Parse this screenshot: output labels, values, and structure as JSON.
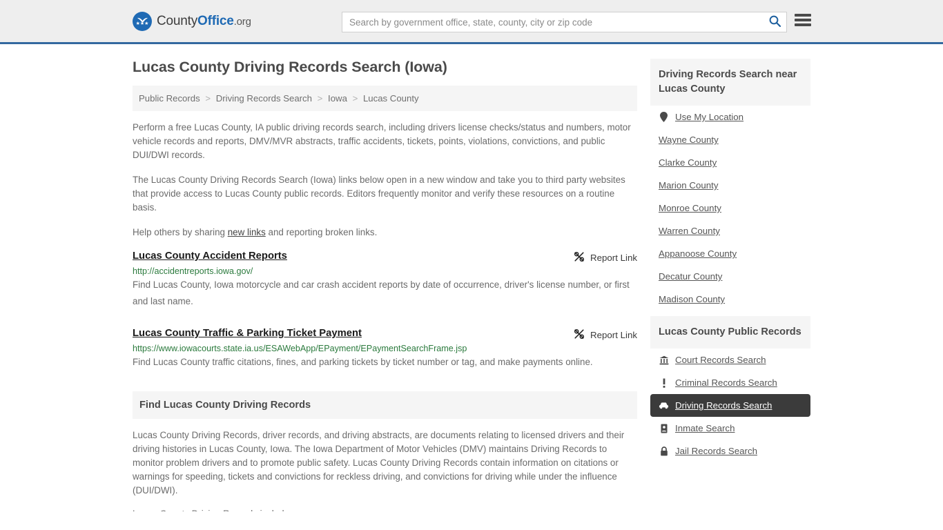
{
  "header": {
    "logo": {
      "part1": "County",
      "part2": "Office",
      "part3": ".org",
      "icon": "eagle-seal-icon",
      "stars": "★★★"
    },
    "search": {
      "placeholder": "Search by government office, state, county, city or zip code",
      "value": "",
      "icon": "search-icon"
    },
    "menu_icon": "hamburger-menu-icon",
    "accent_color": "#33689f"
  },
  "main": {
    "title": "Lucas County Driving Records Search (Iowa)",
    "breadcrumb": [
      {
        "label": "Public Records"
      },
      {
        "label": "Driving Records Search"
      },
      {
        "label": "Iowa"
      },
      {
        "label": "Lucas County"
      }
    ],
    "breadcrumb_separator": ">",
    "paragraphs": [
      "Perform a free Lucas County, IA public driving records search, including drivers license checks/status and numbers, motor vehicle records and reports, DMV/MVR abstracts, traffic accidents, tickets, points, violations, convictions, and public DUI/DWI records.",
      "The Lucas County Driving Records Search (Iowa) links below open in a new window and take you to third party websites that provide access to Lucas County public records. Editors frequently monitor and verify these resources on a routine basis."
    ],
    "help_text_before": "Help others by sharing ",
    "help_link": "new links",
    "help_text_after": " and reporting broken links.",
    "report_link_label": "Report Link",
    "report_link_icon": "broken-link-icon",
    "results": [
      {
        "title": "Lucas County Accident Reports",
        "url": "http://accidentreports.iowa.gov/",
        "description": "Find Lucas County, Iowa motorcycle and car crash accident reports by date of occurrence, driver's license number, or first and last name."
      },
      {
        "title": "Lucas County Traffic & Parking Ticket Payment",
        "url": "https://www.iowacourts.state.ia.us/ESAWebApp/EPayment/EPaymentSearchFrame.jsp",
        "description": "Find Lucas County traffic citations, fines, and parking tickets by ticket number or tag, and make payments online."
      }
    ],
    "section": {
      "heading": "Find Lucas County Driving Records",
      "body": "Lucas County Driving Records, driver records, and driving abstracts, are documents relating to licensed drivers and their driving histories in Lucas County, Iowa. The Iowa Department of Motor Vehicles (DMV) maintains Driving Records to monitor problem drivers and to promote public safety. Lucas County Driving Records contain information on citations or warnings for speeding, tickets and convictions for reckless driving, and convictions for driving while under the influence (DUI/DWI).",
      "next_partial": "Lucas County Driving Records include"
    }
  },
  "sidebar": {
    "nearby": {
      "heading": "Driving Records Search near Lucas County",
      "items": [
        {
          "label": "Use My Location",
          "icon": "map-pin-icon"
        },
        {
          "label": "Wayne County",
          "icon": ""
        },
        {
          "label": "Clarke County",
          "icon": ""
        },
        {
          "label": "Marion County",
          "icon": ""
        },
        {
          "label": "Monroe County",
          "icon": ""
        },
        {
          "label": "Warren County",
          "icon": ""
        },
        {
          "label": "Appanoose County",
          "icon": ""
        },
        {
          "label": "Decatur County",
          "icon": ""
        },
        {
          "label": "Madison County",
          "icon": ""
        }
      ]
    },
    "public_records": {
      "heading": "Lucas County Public Records",
      "items": [
        {
          "label": "Court Records Search",
          "icon": "courthouse-icon",
          "active": false
        },
        {
          "label": "Criminal Records Search",
          "icon": "exclamation-icon",
          "active": false
        },
        {
          "label": "Driving Records Search",
          "icon": "car-icon",
          "active": true
        },
        {
          "label": "Inmate Search",
          "icon": "id-card-icon",
          "active": false
        },
        {
          "label": "Jail Records Search",
          "icon": "lock-icon",
          "active": false
        }
      ]
    }
  }
}
